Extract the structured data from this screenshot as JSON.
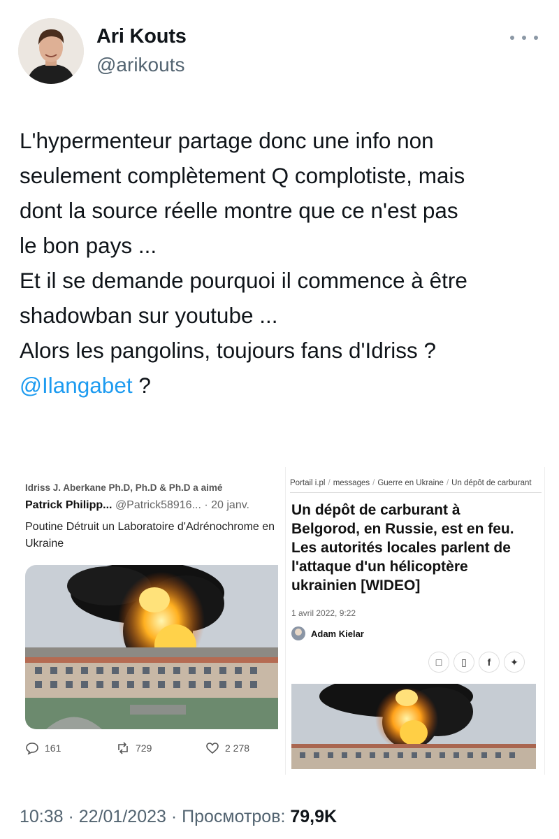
{
  "author": {
    "name": "Ari Kouts",
    "handle": "@arikouts",
    "avatar_icon": "avatar-photo"
  },
  "tweet": {
    "lines": [
      "L'hypermenteur partage donc une info non",
      "seulement complètement Q complotiste, mais",
      "dont la source réelle montre que ce n'est pas",
      "le bon pays ...",
      "Et il se demande pourquoi il commence à être",
      "shadowban sur youtube ...",
      "Alors les pangolins, toujours fans d'Idriss ?"
    ],
    "mention": "@Ilangabet",
    "mention_suffix": " ?"
  },
  "media": {
    "left": {
      "liked_by": "Idriss J. Aberkane Ph.D, Ph.D & Ph.D a aimé",
      "quoted_name": "Patrick Philipp...",
      "quoted_handle": "@Patrick58916...",
      "quoted_time": "· 20 janv.",
      "quoted_text": [
        "Poutine Détruit un Laboratoire d'Adrénochrome en",
        "Ukraine"
      ],
      "replies": "161",
      "retweets": "729",
      "likes": "2 278"
    },
    "right": {
      "breadcrumbs": [
        "Portail i.pl",
        "messages",
        "Guerre en Ukraine",
        "Un dépôt de carburant"
      ],
      "headline": [
        "Un dépôt de carburant à",
        "Belgorod, en Russie, est en feu.",
        "Les autorités locales parlent de",
        "l'attaque d'un hélicoptère",
        "ukrainien [WIDEO]"
      ],
      "date": "1 avril 2022, 9:22",
      "author": "Adam Kielar"
    }
  },
  "footer": {
    "timestamp": "10:38 · 22/01/2023 · ",
    "views_label": "Просмотров: ",
    "views_count": "79,9K"
  },
  "colors": {
    "mention": "#1d9bf0",
    "secondary_text": "#536471",
    "fire": "#ff8c1a",
    "smoke": "#1a1a1a"
  }
}
